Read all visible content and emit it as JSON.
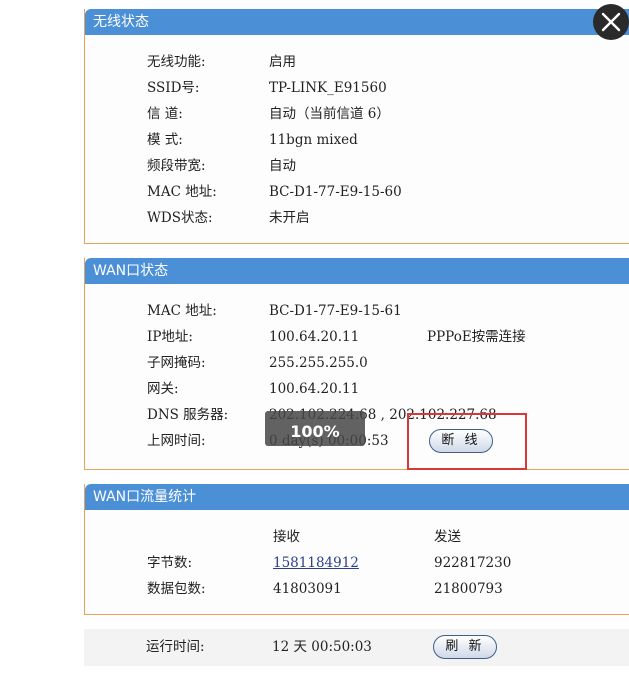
{
  "wireless": {
    "title": "无线状态",
    "rows": [
      {
        "label": "无线功能:",
        "value": "启用"
      },
      {
        "label": "SSID号:",
        "value": "TP-LINK_E91560"
      },
      {
        "label": "信 道:",
        "value": "自动（当前信道 6）"
      },
      {
        "label": "模 式:",
        "value": "11bgn mixed"
      },
      {
        "label": "频段带宽:",
        "value": "自动"
      },
      {
        "label": "MAC 地址:",
        "value": "BC-D1-77-E9-15-60"
      },
      {
        "label": "WDS状态:",
        "value": "未开启"
      }
    ]
  },
  "wan": {
    "title": "WAN口状态",
    "rows": [
      {
        "label": "MAC 地址:",
        "value": "BC-D1-77-E9-15-61"
      },
      {
        "label": "IP地址:",
        "value": "100.64.20.11",
        "extra": "PPPoE按需连接"
      },
      {
        "label": "子网掩码:",
        "value": "255.255.255.0"
      },
      {
        "label": "网关:",
        "value": "100.64.20.11"
      },
      {
        "label": "DNS 服务器:",
        "value": "202.102.224.68 , 202.102.227.68"
      },
      {
        "label": "上网时间:",
        "value": "0 day(s) 00:00:53"
      }
    ],
    "disconnect_label": "断 线",
    "progress_text": "100%"
  },
  "traffic": {
    "title": "WAN口流量统计",
    "col_recv": "接收",
    "col_send": "发送",
    "rows": [
      {
        "label": "字节数:",
        "recv": "1581184912",
        "send": "922817230"
      },
      {
        "label": "数据包数:",
        "recv": "41803091",
        "send": "21800793"
      }
    ]
  },
  "runtime": {
    "label": "运行时间:",
    "value": "12 天 00:50:03",
    "refresh_label": "刷 新"
  },
  "colors": {
    "header_blue": "#4b8fd6",
    "border_orange": "#e8a35a",
    "highlight_red": "#d9383a"
  },
  "icons": {
    "close": "close-icon"
  }
}
